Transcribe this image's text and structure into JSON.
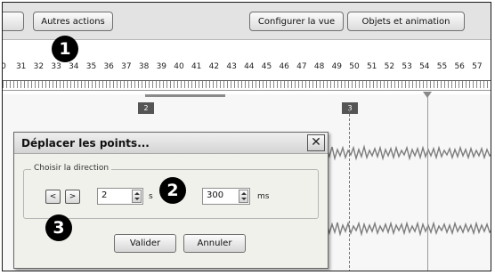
{
  "toolbar": {
    "autres_actions": "Autres actions",
    "configurer_vue": "Configurer la vue",
    "objets_animation": "Objets et animation"
  },
  "ruler": {
    "ticks": [
      "0",
      "31",
      "32",
      "33",
      "34",
      "35",
      "36",
      "37",
      "38",
      "39",
      "40",
      "41",
      "42",
      "43",
      "44",
      "45",
      "46",
      "47",
      "48",
      "49",
      "50",
      "51",
      "52",
      "53",
      "54",
      "55",
      "56",
      "57"
    ]
  },
  "markers": [
    "2",
    "3"
  ],
  "callouts": [
    "1",
    "2",
    "3"
  ],
  "dialog": {
    "title": "Déplacer les points...",
    "close_glyph": "✕",
    "group_label": "Choisir la direction",
    "prev_glyph": "<",
    "next_glyph": ">",
    "seconds_value": "2",
    "seconds_unit": "s",
    "ms_value": "300",
    "ms_unit": "ms",
    "valider": "Valider",
    "annuler": "Annuler"
  }
}
